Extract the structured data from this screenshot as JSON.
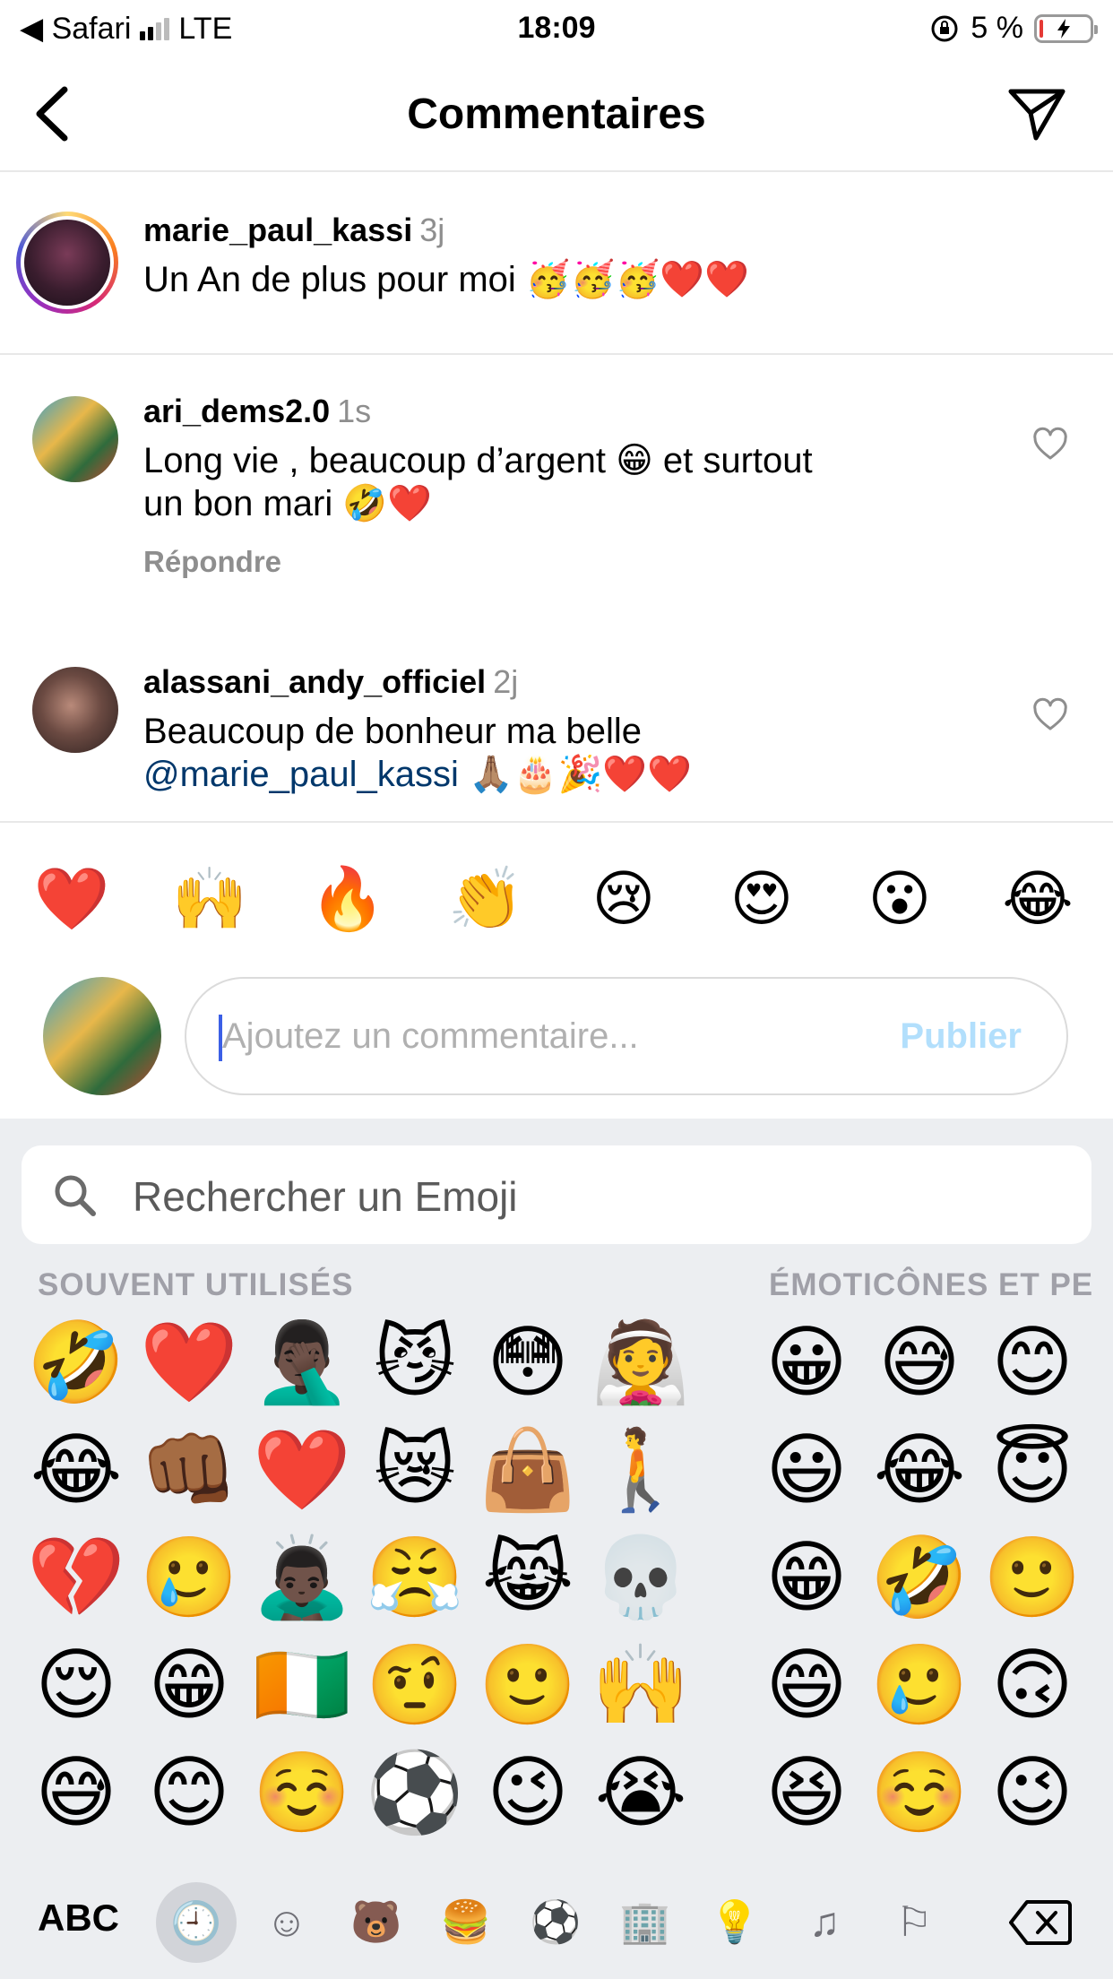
{
  "status_bar": {
    "carrier": "◀ Safari",
    "network": "LTE",
    "time": "18:09",
    "battery": "5 %"
  },
  "header": {
    "title": "Commentaires"
  },
  "comments": [
    {
      "username": "marie_paul_kassi",
      "time": "3j",
      "text": "Un An de plus pour moi 🥳🥳🥳❤️❤️"
    },
    {
      "username": "ari_dems2.0",
      "time": "1s",
      "text_line1": "Long vie , beaucoup d’argent 😁 et surtout",
      "text_line2": "un bon mari 🤣❤️",
      "reply": "Répondre"
    },
    {
      "username": "alassani_andy_officiel",
      "time": "2j",
      "text_line1": "Beaucoup de bonheur ma belle",
      "mention": "@marie_paul_kassi",
      "text_line2_rest": " 🙏🏽🎂🎉❤️❤️"
    }
  ],
  "reactions": [
    "❤️",
    "🙌",
    "🔥",
    "👏",
    "😢",
    "😍",
    "😮",
    "😂"
  ],
  "comment_input": {
    "placeholder": "Ajoutez un commentaire...",
    "publish": "Publier"
  },
  "keyboard": {
    "search_placeholder": "Rechercher un Emoji",
    "section_frequent": "SOUVENT UTILISÉS",
    "section_smileys": "ÉMOTICÔNES ET PE",
    "frequent": [
      [
        "🤣",
        "❤️",
        "🤦🏿‍♂️",
        "😼",
        "😳",
        "👰"
      ],
      [
        "😂",
        "👊🏾",
        "❤️",
        "😿",
        "👜",
        "🚶"
      ],
      [
        "💔",
        "🥲",
        "🙇🏿‍♂️",
        "😤",
        "😹",
        "💀"
      ],
      [
        "😌",
        "😁",
        "🇨🇮",
        "🤨",
        "🙂",
        "🙌"
      ],
      [
        "😅",
        "😊",
        "☺️",
        "⚽",
        "😉",
        "😭"
      ]
    ],
    "smileys": [
      [
        "😀",
        "😅",
        "😊"
      ],
      [
        "😃",
        "😂",
        "😇"
      ],
      [
        "😁",
        "🤣",
        "🙂"
      ],
      [
        "😄",
        "🥲",
        "🙃"
      ],
      [
        "😆",
        "☺️",
        "😉"
      ]
    ],
    "abc": "ABC",
    "categories": [
      "🕘",
      "☺",
      "🐻",
      "🍔",
      "⚽",
      "🏢",
      "💡",
      "♫",
      "⚐"
    ]
  }
}
